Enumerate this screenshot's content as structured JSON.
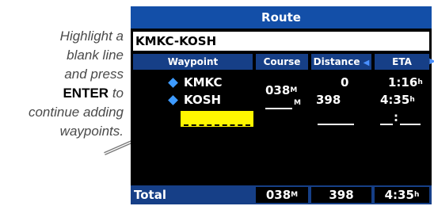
{
  "callout": {
    "line1": "Highlight a",
    "line2": "blank line",
    "line3": "and press",
    "key": "ENTER",
    "line4_after": " to",
    "line5": "continue adding",
    "line6": "waypoints."
  },
  "screen": {
    "title": "Route",
    "route_name": "KMKC-KOSH",
    "columns": {
      "waypoint": "Waypoint",
      "course": "Course",
      "distance": "Distance",
      "eta": "ETA",
      "left_arrow": "◀",
      "right_arrow": "▶"
    },
    "rows": [
      {
        "waypoint": "KMKC",
        "distance": "0",
        "eta": "1:16",
        "eta_unit": "h"
      },
      {
        "waypoint": "KOSH",
        "distance": "398",
        "eta": "4:35",
        "eta_unit": "h"
      }
    ],
    "course_values": {
      "first": "038",
      "first_unit": "M",
      "second_unit": "M"
    },
    "blank_eta": ":",
    "total": {
      "label": "Total",
      "course": "038",
      "course_unit": "M",
      "distance": "398",
      "eta": "4:35",
      "eta_unit": "h"
    },
    "colors": {
      "title_bar": "#134fa8",
      "header_bar": "#163f87",
      "highlight": "#fff700",
      "waypoint_icon": "#3e9bff"
    },
    "icons": {
      "waypoint": "diamond-icon"
    }
  }
}
